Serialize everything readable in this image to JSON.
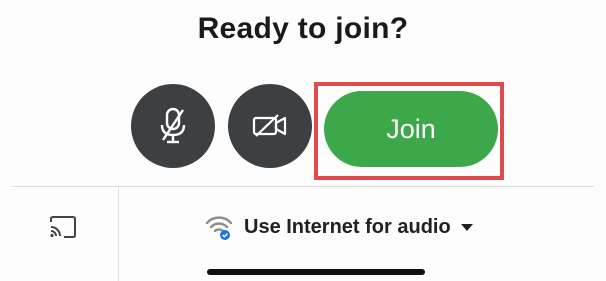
{
  "title": "Ready to join?",
  "controls": {
    "mic_icon": "mic-off-icon",
    "camera_icon": "camera-off-icon",
    "join_label": "Join",
    "join_color": "#3da84a",
    "button_bg": "#3c4043",
    "highlight_color": "#e04a4a"
  },
  "bottom": {
    "cast_icon": "cast-icon",
    "audio_icon": "wifi-audio-icon",
    "audio_label": "Use Internet for audio",
    "dropdown_icon": "caret-down-icon"
  }
}
